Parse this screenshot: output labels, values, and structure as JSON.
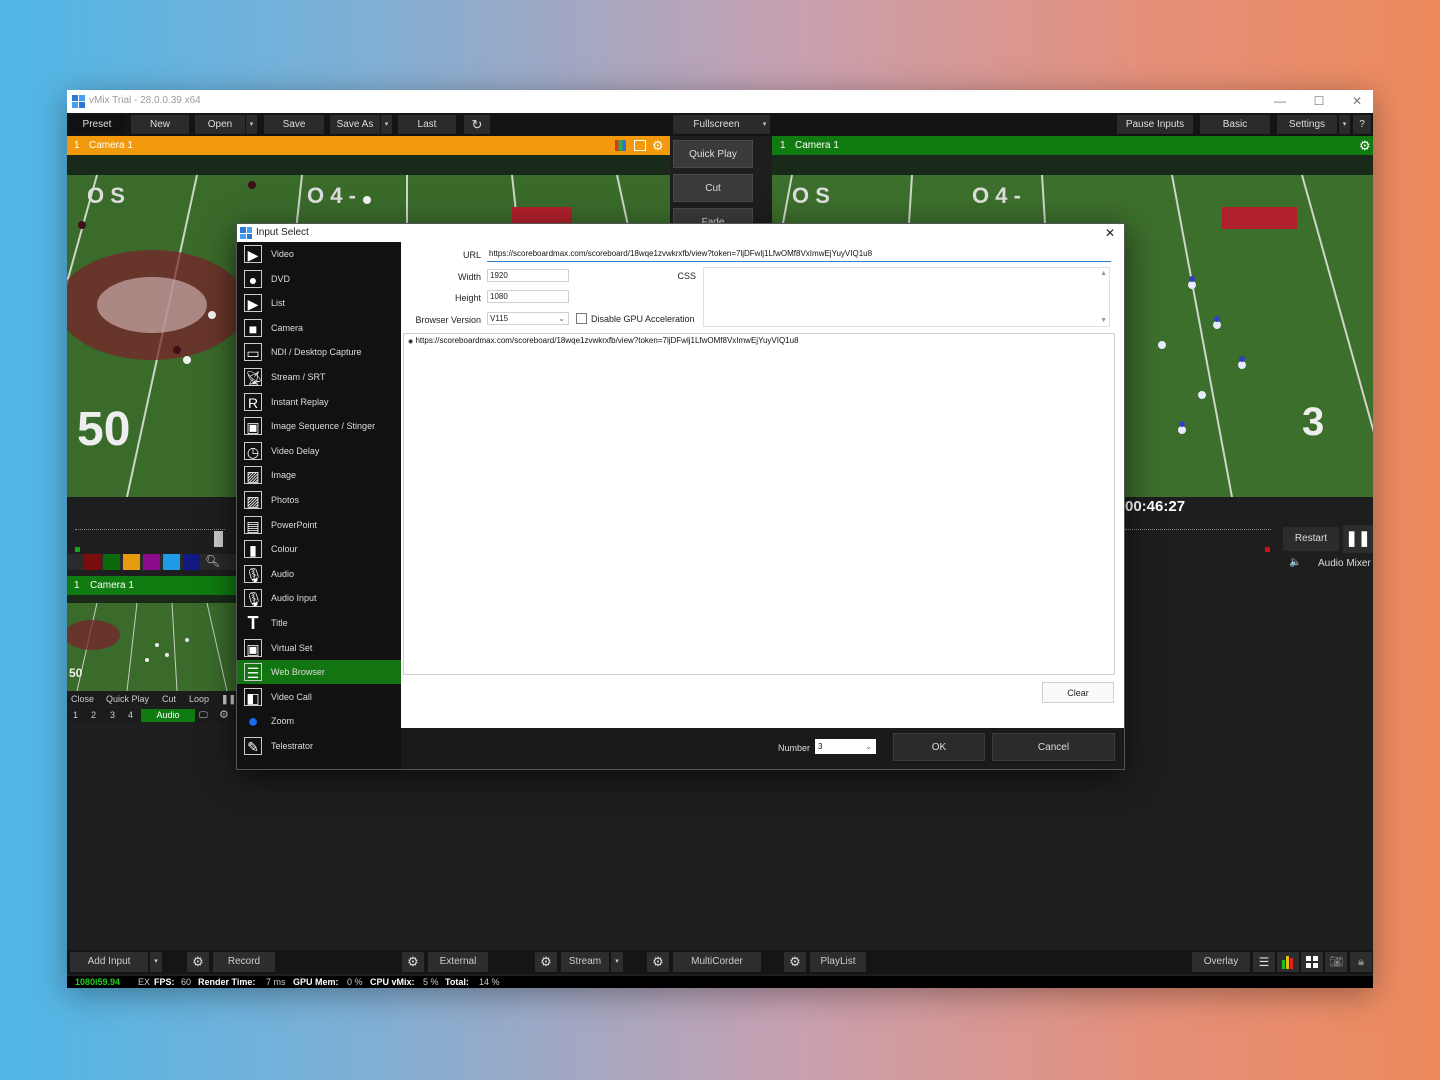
{
  "window": {
    "title": "vMix Trial - 28.0.0.39 x64",
    "controls": [
      "—",
      "☐",
      "✕"
    ]
  },
  "toolbar": {
    "preset": "Preset",
    "new": "New",
    "open": "Open",
    "save": "Save",
    "save_as": "Save As",
    "last": "Last",
    "fullscreen": "Fullscreen",
    "pause_inputs": "Pause Inputs",
    "basic": "Basic",
    "settings": "Settings",
    "help": "?"
  },
  "preview": {
    "number": "1",
    "name": "Camera 1",
    "accent": "#f39a0c"
  },
  "output": {
    "number": "1",
    "name": "Camera 1",
    "accent": "#0f7b10",
    "timecode": "00:46:27"
  },
  "transitions": {
    "quick_play": "Quick Play",
    "cut": "Cut",
    "fade": "Fade"
  },
  "output_controls": {
    "restart": "Restart",
    "audio_mixer": "Audio Mixer"
  },
  "color_swatches": [
    "#7a0d0d",
    "#0c6a0c",
    "#e69b0c",
    "#8a0c8a",
    "#1e9ae8",
    "#111a80"
  ],
  "input_tile": {
    "number": "1",
    "name": "Camera 1",
    "buttons": [
      "Close",
      "Quick Play",
      "Cut",
      "Loop"
    ],
    "numbers": [
      "1",
      "2",
      "3",
      "4"
    ],
    "audio": "Audio"
  },
  "dialog": {
    "title": "Input Select",
    "close": "✕",
    "items": [
      {
        "label": "Video",
        "icon": "video-icon"
      },
      {
        "label": "DVD",
        "icon": "dvd-icon"
      },
      {
        "label": "List",
        "icon": "list-icon"
      },
      {
        "label": "Camera",
        "icon": "camera-icon"
      },
      {
        "label": "NDI / Desktop Capture",
        "icon": "desktop-capture-icon"
      },
      {
        "label": "Stream / SRT",
        "icon": "stream-icon"
      },
      {
        "label": "Instant Replay",
        "icon": "replay-icon"
      },
      {
        "label": "Image Sequence / Stinger",
        "icon": "image-sequence-icon"
      },
      {
        "label": "Video Delay",
        "icon": "video-delay-icon"
      },
      {
        "label": "Image",
        "icon": "image-icon"
      },
      {
        "label": "Photos",
        "icon": "photos-icon"
      },
      {
        "label": "PowerPoint",
        "icon": "powerpoint-icon"
      },
      {
        "label": "Colour",
        "icon": "colour-icon"
      },
      {
        "label": "Audio",
        "icon": "audio-icon"
      },
      {
        "label": "Audio Input",
        "icon": "audio-input-icon"
      },
      {
        "label": "Title",
        "icon": "title-icon"
      },
      {
        "label": "Virtual Set",
        "icon": "virtual-set-icon"
      },
      {
        "label": "Web Browser",
        "icon": "web-browser-icon"
      },
      {
        "label": "Video Call",
        "icon": "video-call-icon"
      },
      {
        "label": "Zoom",
        "icon": "zoom-icon"
      },
      {
        "label": "Telestrator",
        "icon": "telestrator-icon"
      }
    ],
    "selected_item": "Web Browser",
    "url_label": "URL",
    "url_value": "https://scoreboardmax.com/scoreboard/18wqe1zvwkrxfb/view?token=7ljDFwlj1LfwOMf8VxImwEjYuyVIQ1u8",
    "width_label": "Width",
    "width_value": "1920",
    "height_label": "Height",
    "height_value": "1080",
    "css_label": "CSS",
    "browser_version_label": "Browser Version",
    "browser_version_value": "V115",
    "gpu_checkbox_label": "Disable GPU Acceleration",
    "gpu_checked": false,
    "history": [
      "https://scoreboardmax.com/scoreboard/18wqe1zvwkrxfb/view?token=7ljDFwlj1LfwOMf8VxImwEjYuyVIQ1u8"
    ],
    "clear": "Clear",
    "number_label": "Number",
    "number_value": "3",
    "ok": "OK",
    "cancel": "Cancel"
  },
  "statusbar": {
    "add_input": "Add Input",
    "record": "Record",
    "external": "External",
    "stream": "Stream",
    "multicorder": "MultiCorder",
    "playlist": "PlayList",
    "overlay": "Overlay"
  },
  "info": {
    "format": "1080i59.94",
    "fx": "EX",
    "fps_label": "FPS:",
    "fps": "60",
    "render_label": "Render Time:",
    "render": "7 ms",
    "gpu_label": "GPU Mem:",
    "gpu": "0 %",
    "cpu_label": "CPU vMix:",
    "cpu": "5 %",
    "total_label": "Total:",
    "total": "14 %"
  }
}
